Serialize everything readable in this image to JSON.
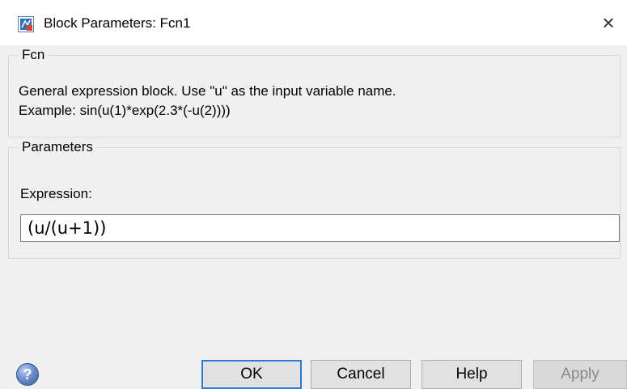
{
  "window": {
    "title": "Block Parameters: Fcn1",
    "close_glyph": "×",
    "app_icon": "simulink-block-icon"
  },
  "fcn_group": {
    "legend": "Fcn",
    "description_line1": "General expression block. Use \"u\" as the input variable name.",
    "description_line2": "Example: sin(u(1)*exp(2.3*(-u(2))))"
  },
  "params_group": {
    "legend": "Parameters",
    "expression_label": "Expression:",
    "expression_value": "(u/(u+1))"
  },
  "buttons": {
    "help_icon_glyph": "?",
    "ok": "OK",
    "cancel": "Cancel",
    "help": "Help",
    "apply": "Apply"
  },
  "colors": {
    "accent_focus_border": "#2d7bd4",
    "disabled_text": "#8a8a8a"
  }
}
